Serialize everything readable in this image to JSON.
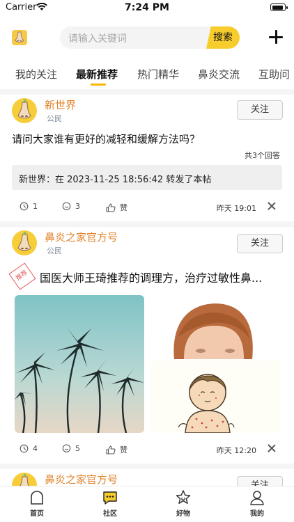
{
  "status_bar": {
    "carrier": "Carrier",
    "time": "7:24 PM"
  },
  "header": {
    "logo_icon": "nose-logo-icon",
    "search": {
      "placeholder": "请输入关键词",
      "button_label": "搜索"
    },
    "add_icon": "plus-icon"
  },
  "tabs": [
    "我的关注",
    "最新推荐",
    "热门精华",
    "鼻炎交流",
    "互助问"
  ],
  "active_tab": "最新推荐",
  "posts": [
    {
      "author": "新世界",
      "rank": "公民",
      "follow_label": "关注",
      "text": "请问大家谁有更好的减轻和缓解方法吗？",
      "answer_count": "共3个回答",
      "repost": "新世界：在 2023-11-25 18:56:42 转发了本帖",
      "views": "1",
      "comments": "3",
      "like_label": "赞",
      "time": "昨天 19:01"
    },
    {
      "author": "鼻炎之家官方号",
      "rank": "公民",
      "follow_label": "关注",
      "badge": "推荐",
      "text": "国医大师王琦推荐的调理方，治疗过敏性鼻...",
      "views": "4",
      "comments": "5",
      "like_label": "赞",
      "time": "昨天 12:20"
    },
    {
      "author": "鼻炎之家官方号",
      "follow_label": "关注"
    }
  ],
  "tabbar": [
    {
      "label": "首页",
      "icon": "home-icon"
    },
    {
      "label": "社区",
      "icon": "community-chat-icon"
    },
    {
      "label": "好物",
      "icon": "star-goods-icon"
    },
    {
      "label": "我的",
      "icon": "profile-icon"
    }
  ],
  "colors": {
    "accent": "#f7cd2e",
    "author": "#e0832a",
    "underline": "#f7b500"
  }
}
